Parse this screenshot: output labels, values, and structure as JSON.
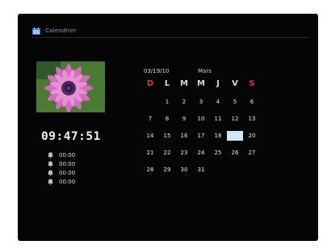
{
  "header": {
    "title": "Calendrier",
    "icon": "calendar-icon"
  },
  "clock": {
    "time": "09:47:51"
  },
  "alarms": [
    {
      "time": "00:00",
      "icon": "alarm-bell-icon"
    },
    {
      "time": "00:00",
      "icon": "alarm-bell-icon"
    },
    {
      "time": "00:00",
      "icon": "alarm-bell-icon"
    },
    {
      "time": "00:00",
      "icon": "alarm-bell-icon"
    }
  ],
  "calendar": {
    "date": "03/19/10",
    "month": "Mars",
    "weekdays": [
      "D",
      "L",
      "M",
      "M",
      "J",
      "V",
      "S"
    ],
    "weeks": [
      [
        "",
        "1",
        "2",
        "3",
        "4",
        "5",
        "6"
      ],
      [
        "7",
        "8",
        "9",
        "10",
        "11",
        "12",
        "13"
      ],
      [
        "14",
        "15",
        "16",
        "17",
        "18",
        "",
        "20"
      ],
      [
        "21",
        "22",
        "23",
        "24",
        "25",
        "26",
        "27"
      ],
      [
        "28",
        "29",
        "30",
        "31",
        "",
        "",
        ""
      ]
    ],
    "selected_day": "19"
  },
  "colors": {
    "weekend": "#e03030",
    "selection": "#cfe6f7",
    "header_text": "#8aa0c2"
  }
}
